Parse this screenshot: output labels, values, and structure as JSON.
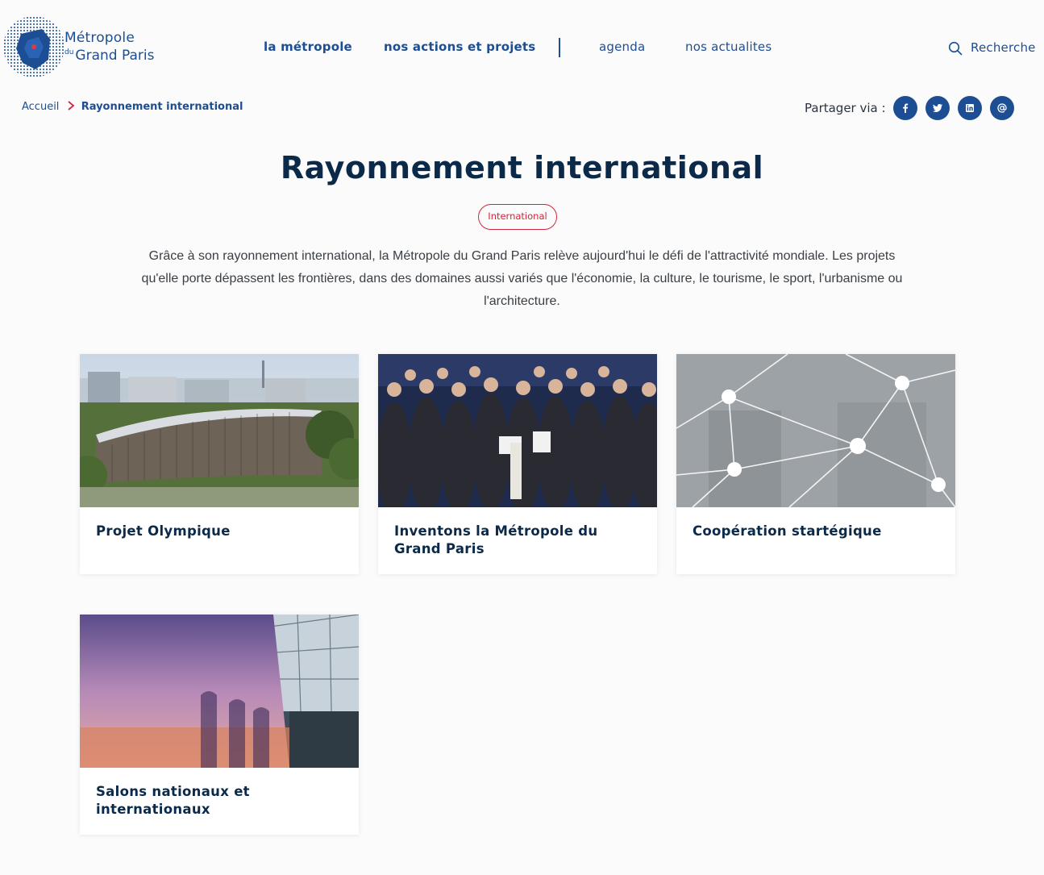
{
  "header": {
    "logo": {
      "line1": "Métropole",
      "du": "du",
      "line2": "Grand Paris"
    },
    "nav": [
      {
        "label": "la métropole",
        "bold": true
      },
      {
        "label": "nos actions et projets",
        "bold": true
      },
      {
        "label": "agenda",
        "bold": false
      },
      {
        "label": "nos actualites",
        "bold": false
      }
    ],
    "search_label": "Recherche"
  },
  "breadcrumb": {
    "home": "Accueil",
    "current": "Rayonnement international"
  },
  "share": {
    "label": "Partager via :",
    "networks": [
      "facebook-icon",
      "twitter-icon",
      "linkedin-icon",
      "email-at-icon"
    ]
  },
  "page": {
    "title": "Rayonnement international",
    "tag": "International",
    "intro": "Grâce à son rayonnement international, la Métropole du Grand Paris relève aujourd'hui le défi de l'attractivité mondiale. Les projets qu'elle porte dépassent les frontières, dans des domaines aussi variés que l'économie, la culture, le tourisme, le sport, l'urbanisme ou l'architecture."
  },
  "cards": [
    {
      "title": "Projet Olympique"
    },
    {
      "title": "Inventons la Métropole du Grand Paris"
    },
    {
      "title": "Coopération startégique"
    },
    {
      "title": "Salons nationaux et internationaux"
    }
  ],
  "colors": {
    "brand_blue": "#1d4e93",
    "accent_red": "#d0263a",
    "title_navy": "#0b2a4a"
  }
}
